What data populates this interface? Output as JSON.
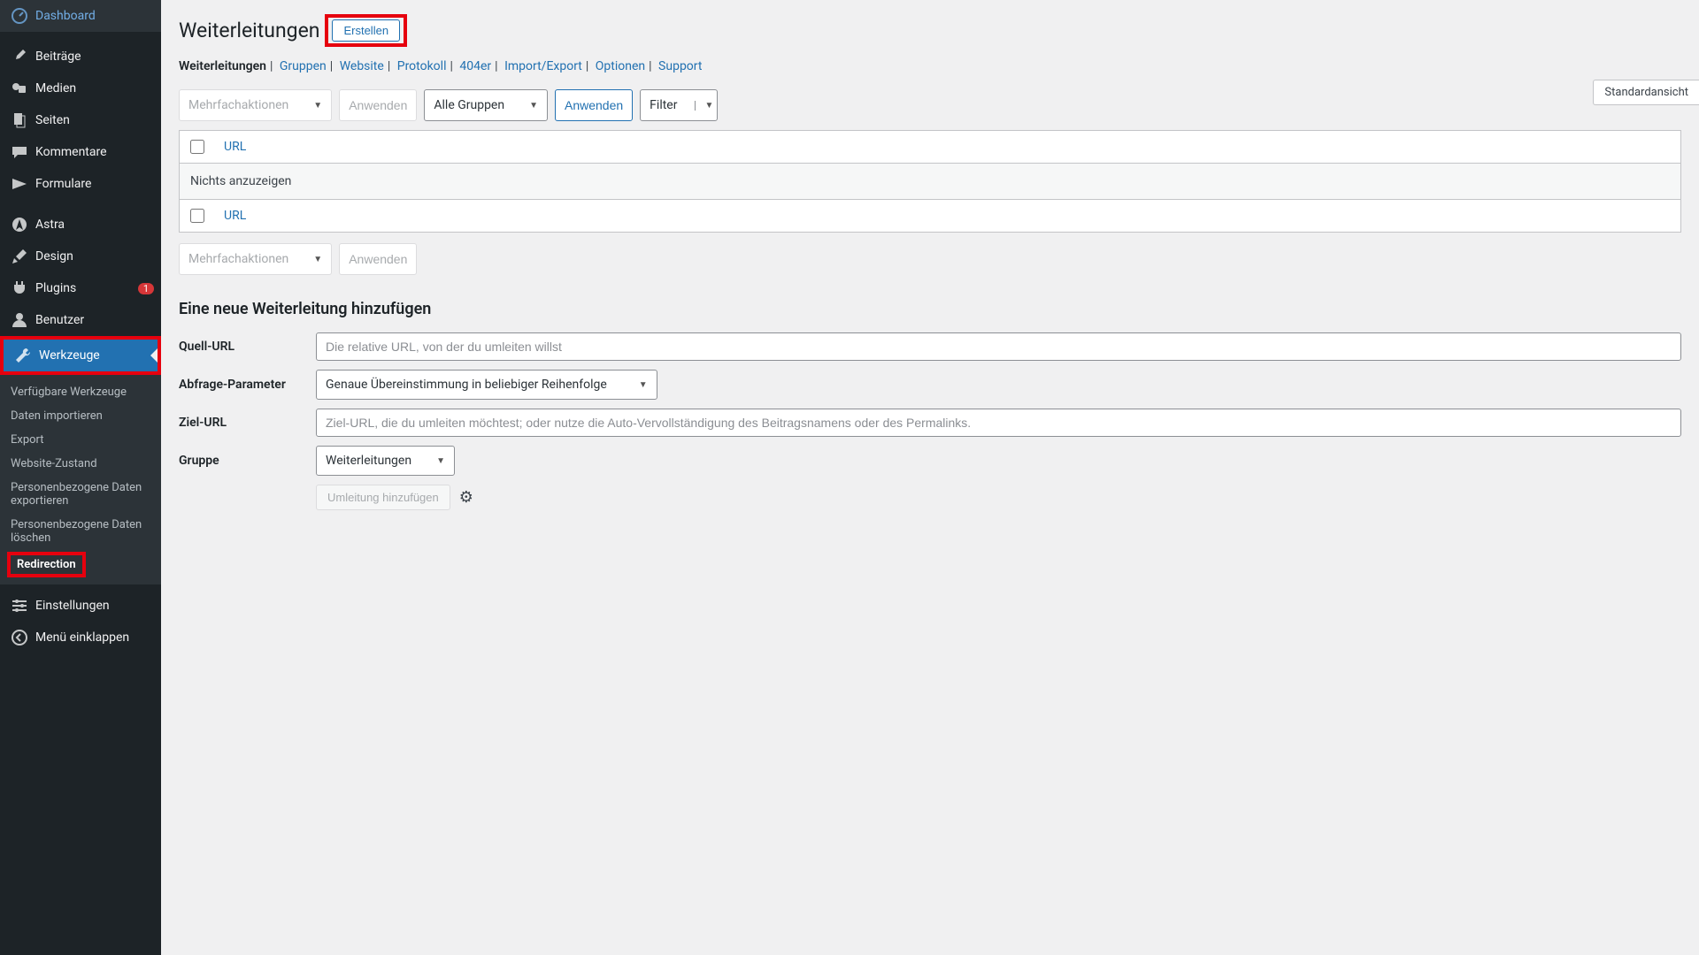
{
  "sidebar": {
    "main": [
      {
        "icon": "dashboard",
        "label": "Dashboard"
      },
      {
        "icon": "pin",
        "label": "Beiträge"
      },
      {
        "icon": "media",
        "label": "Medien"
      },
      {
        "icon": "pages",
        "label": "Seiten"
      },
      {
        "icon": "comments",
        "label": "Kommentare"
      },
      {
        "icon": "forms",
        "label": "Formulare"
      },
      {
        "icon": "astra",
        "label": "Astra"
      },
      {
        "icon": "brush",
        "label": "Design"
      },
      {
        "icon": "plugin",
        "label": "Plugins",
        "badge": "1"
      },
      {
        "icon": "user",
        "label": "Benutzer"
      },
      {
        "icon": "wrench",
        "label": "Werkzeuge",
        "active": true
      }
    ],
    "submenu": [
      {
        "label": "Verfügbare Werkzeuge"
      },
      {
        "label": "Daten importieren"
      },
      {
        "label": "Export"
      },
      {
        "label": "Website-Zustand"
      },
      {
        "label": "Personenbezogene Daten exportieren"
      },
      {
        "label": "Personenbezogene Daten löschen"
      },
      {
        "label": "Redirection",
        "current": true
      }
    ],
    "bottom": [
      {
        "icon": "settings",
        "label": "Einstellungen"
      },
      {
        "icon": "collapse",
        "label": "Menü einklappen"
      }
    ]
  },
  "header": {
    "title": "Weiterleitungen",
    "create_btn": "Erstellen",
    "view_toggle": "Standardansicht"
  },
  "subnav": [
    {
      "label": "Weiterleitungen",
      "active": true
    },
    {
      "label": "Gruppen"
    },
    {
      "label": "Website"
    },
    {
      "label": "Protokoll"
    },
    {
      "label": "404er"
    },
    {
      "label": "Import/Export"
    },
    {
      "label": "Optionen"
    },
    {
      "label": "Support"
    }
  ],
  "toolbar": {
    "bulk": "Mehrfachaktionen",
    "apply": "Anwenden",
    "groups": "Alle Gruppen",
    "apply2": "Anwenden",
    "filter": "Filter"
  },
  "table": {
    "col_url": "URL",
    "empty": "Nichts anzuzeigen"
  },
  "toolbar2": {
    "bulk": "Mehrfachaktionen",
    "apply": "Anwenden"
  },
  "form": {
    "title": "Eine neue Weiterleitung hinzufügen",
    "source_label": "Quell-URL",
    "source_ph": "Die relative URL, von der du umleiten willst",
    "query_label": "Abfrage-Parameter",
    "query_value": "Genaue Übereinstimmung in beliebiger Reihenfolge",
    "target_label": "Ziel-URL",
    "target_ph": "Ziel-URL, die du umleiten möchtest; oder nutze die Auto-Vervollständigung des Beitragsnamens oder des Permalinks.",
    "group_label": "Gruppe",
    "group_value": "Weiterleitungen",
    "submit": "Umleitung hinzufügen"
  }
}
